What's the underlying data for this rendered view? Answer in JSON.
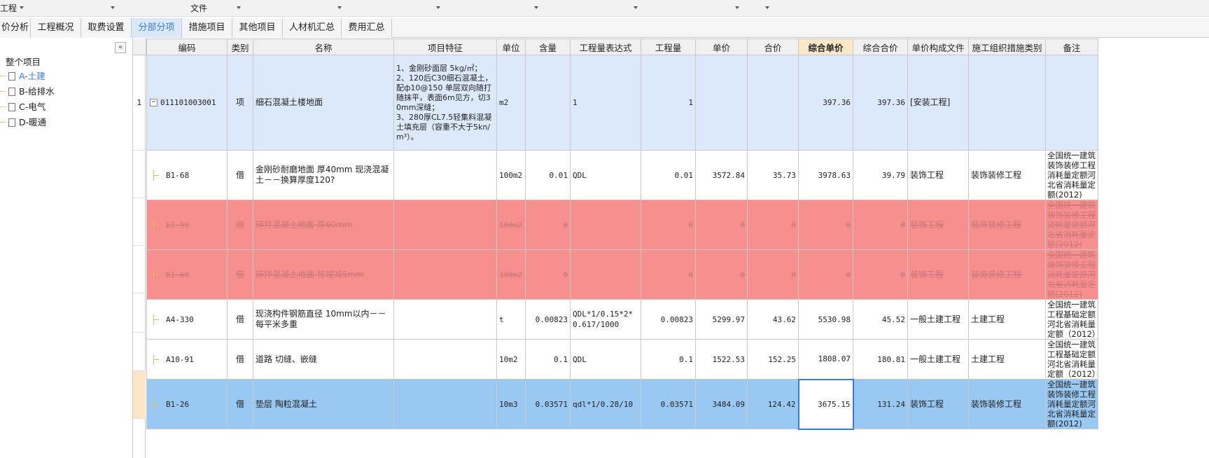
{
  "toolbar": {
    "left_label": "工程",
    "file_label": "文件"
  },
  "tabs": [
    {
      "label": "价分析",
      "active": false
    },
    {
      "label": "工程概况",
      "active": false
    },
    {
      "label": "取费设置",
      "active": false
    },
    {
      "label": "分部分项",
      "active": true
    },
    {
      "label": "措施项目",
      "active": false
    },
    {
      "label": "其他项目",
      "active": false
    },
    {
      "label": "人材机汇总",
      "active": false
    },
    {
      "label": "费用汇总",
      "active": false
    }
  ],
  "tree": {
    "collapse_icon": "«",
    "root": "整个项目",
    "children": [
      "A-土建",
      "B-给排水",
      "C-电气",
      "D-暖通"
    ],
    "selected_index": 0
  },
  "columns": [
    "编码",
    "类别",
    "名称",
    "项目特征",
    "单位",
    "含量",
    "工程量表达式",
    "工程量",
    "单价",
    "合价",
    "综合单价",
    "综合合价",
    "单价构成文件",
    "施工组织措施类别",
    "备注"
  ],
  "highlighted_column": "综合单价",
  "rows": [
    {
      "row_no": "1",
      "type": "main",
      "code": "011101003001",
      "cat": "项",
      "name": "细石混凝土楼地面",
      "feature": "1、金刚砂面层 5kg/㎡；\n2、120后C30细石混凝土，配ф10@150 单层双向随打随抹平，表面6m见方，切30mm深缝；\n3、280厚CL7.5轻集料混凝土填充层（容重不大于5kn/m³）。",
      "unit": "m2",
      "content": "",
      "expr": "1",
      "qty": "1",
      "price": "",
      "total": "",
      "comp_price": "397.36",
      "comp_total": "397.36",
      "file": "[安装工程]",
      "measure": "",
      "note": ""
    },
    {
      "row_no": "",
      "type": "sub",
      "code": "B1-68",
      "cat": "借",
      "name": "金刚砂耐磨地面 厚40mm 现浇混凝土－－换算厚度120?",
      "feature": "",
      "unit": "100m2",
      "content": "0.01",
      "expr": "QDL",
      "qty": "0.01",
      "price": "3572.84",
      "total": "35.73",
      "comp_price": "3978.63",
      "comp_total": "39.79",
      "file": "装饰工程",
      "measure": "装饰装修工程",
      "note": "全国统一建筑装饰装修工程消耗量定额河北省消耗量定额(2012)"
    },
    {
      "row_no": "",
      "type": "deleted",
      "code": "B1-59",
      "cat": "借",
      "name": "碎拌混凝土地面 厚60mm",
      "feature": "",
      "unit": "100m2",
      "content": "0",
      "expr": "",
      "qty": "0",
      "price": "0",
      "total": "0",
      "comp_price": "0",
      "comp_total": "0",
      "file": "装饰工程",
      "measure": "装饰装修工程",
      "note": "全国统一建筑装饰装修工程消耗量定额河北省消耗量定额(2012)"
    },
    {
      "row_no": "",
      "type": "deleted",
      "code": "B1-60",
      "cat": "借",
      "name": "碎拌混凝土地面 每增减5mm",
      "feature": "",
      "unit": "100m2",
      "content": "0",
      "expr": "",
      "qty": "0",
      "price": "0",
      "total": "0",
      "comp_price": "0",
      "comp_total": "0",
      "file": "装饰工程",
      "measure": "装饰装修工程",
      "note": "全国统一建筑装饰装修工程消耗量定额河北省消耗量定额(2012)"
    },
    {
      "row_no": "",
      "type": "sub",
      "code": "A4-330",
      "cat": "借",
      "name": "现浇构件钢筋直径 10mm以内－－每平米多重",
      "feature": "",
      "unit": "t",
      "content": "0.00823",
      "expr": "QDL*1/0.15*2*0.617/1000",
      "qty": "0.00823",
      "price": "5299.97",
      "total": "43.62",
      "comp_price": "5530.98",
      "comp_total": "45.52",
      "file": "一般土建工程",
      "measure": "土建工程",
      "note": "全国统一建筑工程基础定额河北省消耗量定额（2012）"
    },
    {
      "row_no": "",
      "type": "sub",
      "code": "A10-91",
      "cat": "借",
      "name": "道路 切缝、嵌缝",
      "feature": "",
      "unit": "10m2",
      "content": "0.1",
      "expr": "QDL",
      "qty": "0.1",
      "price": "1522.53",
      "total": "152.25",
      "comp_price": "1808.07",
      "comp_total": "180.81",
      "file": "一般土建工程",
      "measure": "土建工程",
      "note": "全国统一建筑工程基础定额河北省消耗量定额（2012）"
    },
    {
      "row_no": "",
      "type": "selected",
      "code": "B1-26",
      "cat": "借",
      "name": "垫层 陶粒混凝土",
      "feature": "",
      "unit": "10m3",
      "content": "0.03571",
      "expr": "qdl*1/0.28/10",
      "qty": "0.03571",
      "price": "3484.09",
      "total": "124.42",
      "comp_price": "3675.15",
      "comp_total": "131.24",
      "file": "装饰工程",
      "measure": "装饰装修工程",
      "note": "全国统一建筑装饰装修工程消耗量定额河北省消耗量定额(2012)"
    }
  ]
}
